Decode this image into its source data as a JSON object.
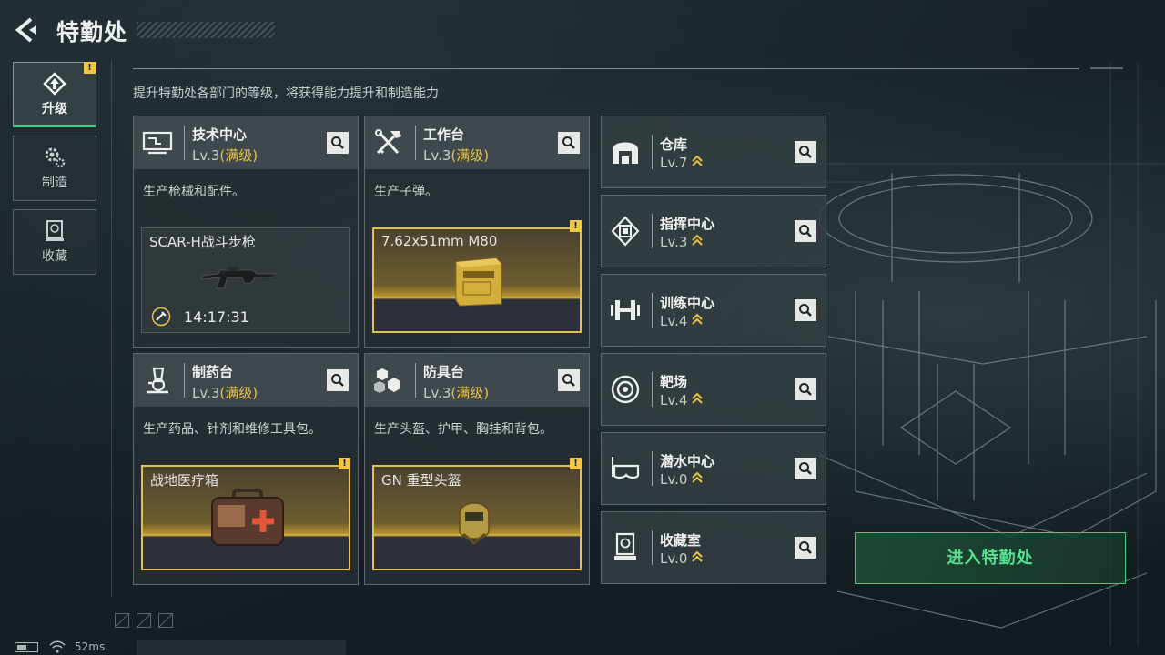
{
  "header": {
    "title": "特勤处"
  },
  "subtitle": "提升特勤处各部门的等级，将获得能力提升和制造能力",
  "tabs": [
    {
      "label": "升级",
      "icon": "upgrade-icon",
      "active": true,
      "warning": "!"
    },
    {
      "label": "制造",
      "icon": "gears-icon",
      "active": false
    },
    {
      "label": "收藏",
      "icon": "collection-icon",
      "active": false
    }
  ],
  "cards": [
    {
      "name": "技术中心",
      "level": "Lv.3",
      "max": "(满级)",
      "icon": "computer-icon",
      "desc": "生产枪械和配件。",
      "slot_name": "SCAR-H战斗步枪",
      "timer": "14:17:31",
      "item_icon": "rifle-icon"
    },
    {
      "name": "工作台",
      "level": "Lv.3",
      "max": "(满级)",
      "icon": "tools-icon",
      "desc": "生产子弹。",
      "slot_name": "7.62x51mm M80",
      "warning": "!",
      "item_icon": "ammo-box-icon"
    },
    {
      "name": "制药台",
      "level": "Lv.3",
      "max": "(满级)",
      "icon": "microscope-icon",
      "desc": "生产药品、针剂和维修工具包。",
      "slot_name": "战地医疗箱",
      "warning": "!",
      "item_icon": "medkit-icon"
    },
    {
      "name": "防具台",
      "level": "Lv.3",
      "max": "(满级)",
      "icon": "armor-blocks-icon",
      "desc": "生产头盔、护甲、胸挂和背包。",
      "slot_name": "GN 重型头盔",
      "warning": "!",
      "item_icon": "helmet-icon"
    }
  ],
  "facilities": [
    {
      "name": "仓库",
      "level": "Lv.7",
      "icon": "warehouse-icon"
    },
    {
      "name": "指挥中心",
      "level": "Lv.3",
      "icon": "chip-icon"
    },
    {
      "name": "训练中心",
      "level": "Lv.4",
      "icon": "dumbbell-icon"
    },
    {
      "name": "靶场",
      "level": "Lv.4",
      "icon": "target-icon"
    },
    {
      "name": "潜水中心",
      "level": "Lv.0",
      "icon": "diving-mask-icon"
    },
    {
      "name": "收藏室",
      "level": "Lv.0",
      "icon": "display-case-icon"
    }
  ],
  "enter_button": "进入特勤处",
  "status": {
    "ping": "52ms"
  },
  "colors": {
    "accent_green": "#4fd58b",
    "gold": "#e8c34c",
    "warning": "#f0c846"
  }
}
